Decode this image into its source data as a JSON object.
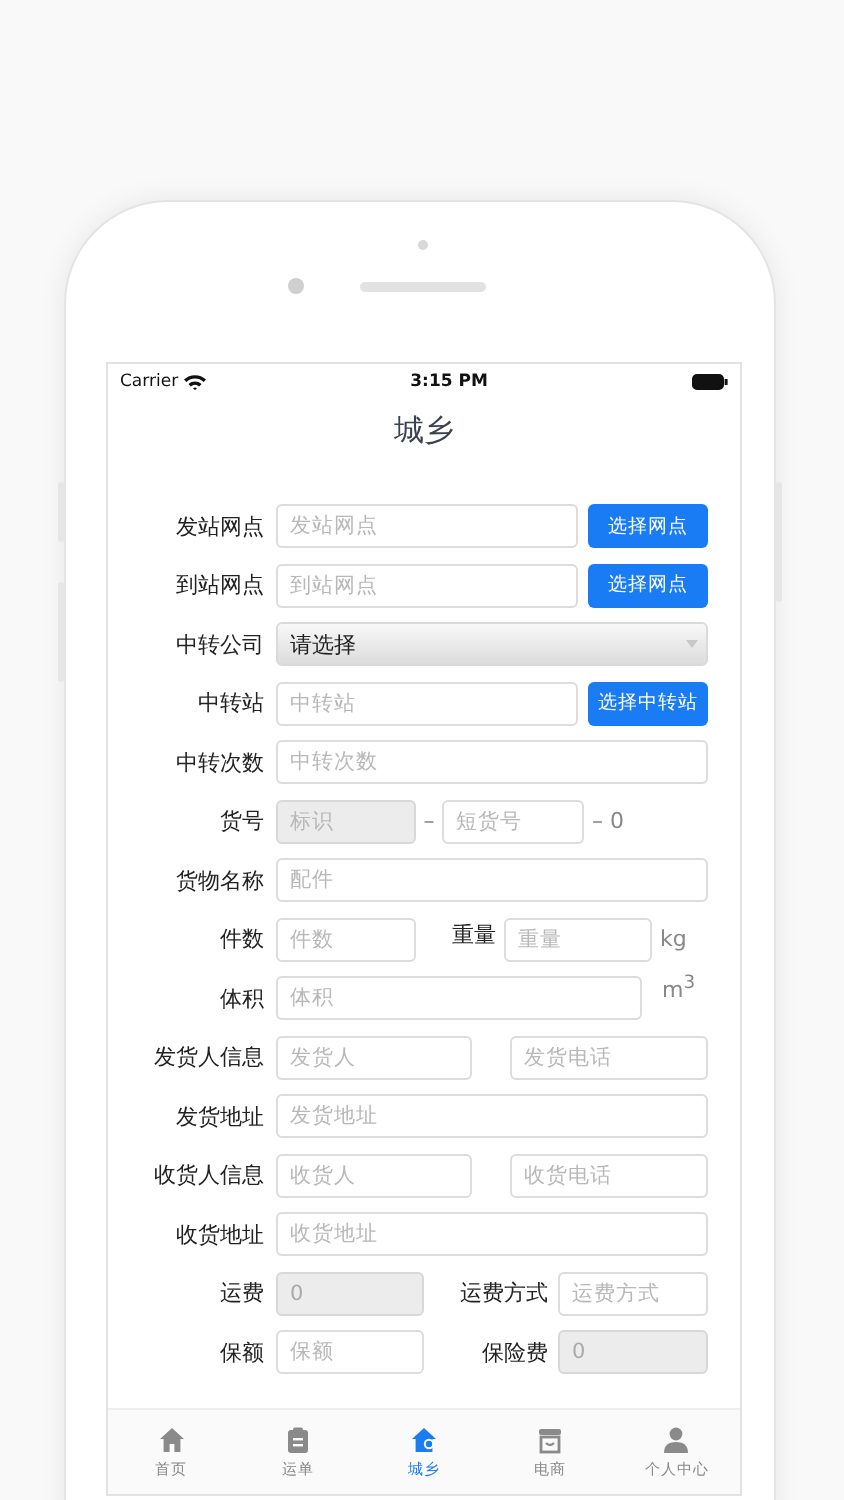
{
  "status_bar": {
    "carrier": "Carrier",
    "time": "3:15 PM"
  },
  "title": "城乡",
  "rows": [
    {
      "label": "发站网点",
      "kind": "input_button",
      "items": [
        {
          "kind": "input",
          "placeholder": "发站网点",
          "disabled": false
        },
        {
          "kind": "button",
          "label": "选择网点"
        }
      ]
    },
    {
      "label": "到站网点",
      "kind": "input_button",
      "items": [
        {
          "kind": "input",
          "placeholder": "到站网点",
          "disabled": false
        },
        {
          "kind": "button",
          "label": "选择网点"
        }
      ]
    },
    {
      "label": "中转公司",
      "kind": "select",
      "items": [
        {
          "kind": "select",
          "value": "请选择"
        }
      ]
    },
    {
      "label": "中转站",
      "kind": "input_button",
      "items": [
        {
          "kind": "input",
          "placeholder": "中转站",
          "disabled": false
        },
        {
          "kind": "button",
          "label": "选择中转站"
        }
      ]
    },
    {
      "label": "中转次数",
      "kind": "full",
      "items": [
        {
          "kind": "input",
          "placeholder": "中转次数",
          "disabled": false
        }
      ]
    },
    {
      "label": "货号",
      "kind": "cargo_no",
      "items": [
        {
          "kind": "input",
          "placeholder": "标识",
          "disabled": true
        },
        {
          "kind": "text",
          "text": "–"
        },
        {
          "kind": "input",
          "placeholder": "短货号",
          "disabled": false
        },
        {
          "kind": "text",
          "text": "– 0"
        }
      ]
    },
    {
      "label": "货物名称",
      "kind": "full",
      "items": [
        {
          "kind": "input",
          "placeholder": "配件",
          "disabled": false
        }
      ]
    },
    {
      "label": "件数",
      "kind": "count_weight",
      "items": [
        {
          "kind": "input",
          "placeholder": "件数",
          "disabled": false
        },
        {
          "kind": "label",
          "text": "重量"
        },
        {
          "kind": "input",
          "placeholder": "重量",
          "disabled": false
        },
        {
          "kind": "text",
          "text": "kg"
        }
      ]
    },
    {
      "label": "体积",
      "kind": "volume",
      "items": [
        {
          "kind": "input",
          "placeholder": "体积",
          "disabled": false
        },
        {
          "kind": "text",
          "text": "m$^{3}$"
        }
      ]
    },
    {
      "label": "发货人信息",
      "kind": "pair",
      "items": [
        {
          "kind": "input",
          "placeholder": "发货人",
          "disabled": false
        },
        {
          "kind": "input",
          "placeholder": "发货电话",
          "disabled": false
        }
      ]
    },
    {
      "label": "发货地址",
      "kind": "full",
      "items": [
        {
          "kind": "input",
          "placeholder": "发货地址",
          "disabled": false
        }
      ]
    },
    {
      "label": "收货人信息",
      "kind": "pair",
      "items": [
        {
          "kind": "input",
          "placeholder": "收货人",
          "disabled": false
        },
        {
          "kind": "input",
          "placeholder": "收货电话",
          "disabled": false
        }
      ]
    },
    {
      "label": "收货地址",
      "kind": "full",
      "items": [
        {
          "kind": "input",
          "placeholder": "收货地址",
          "disabled": false
        }
      ]
    },
    {
      "label": "运费",
      "kind": "pair_labeled",
      "items": [
        {
          "kind": "input",
          "value": "0",
          "disabled": true
        },
        {
          "kind": "label",
          "text": "运费方式"
        },
        {
          "kind": "input",
          "placeholder": "运费方式",
          "disabled": false
        }
      ]
    },
    {
      "label": "保额",
      "kind": "pair_labeled",
      "items": [
        {
          "kind": "input",
          "placeholder": "保额",
          "disabled": false
        },
        {
          "kind": "label",
          "text": "保险费"
        },
        {
          "kind": "input",
          "value": "0",
          "disabled": true
        }
      ]
    }
  ],
  "tabs": [
    {
      "label": "首页",
      "selected": false
    },
    {
      "label": "运单",
      "selected": false
    },
    {
      "label": "城乡",
      "selected": true
    },
    {
      "label": "电商",
      "selected": false
    },
    {
      "label": "个人中心",
      "selected": false
    }
  ]
}
